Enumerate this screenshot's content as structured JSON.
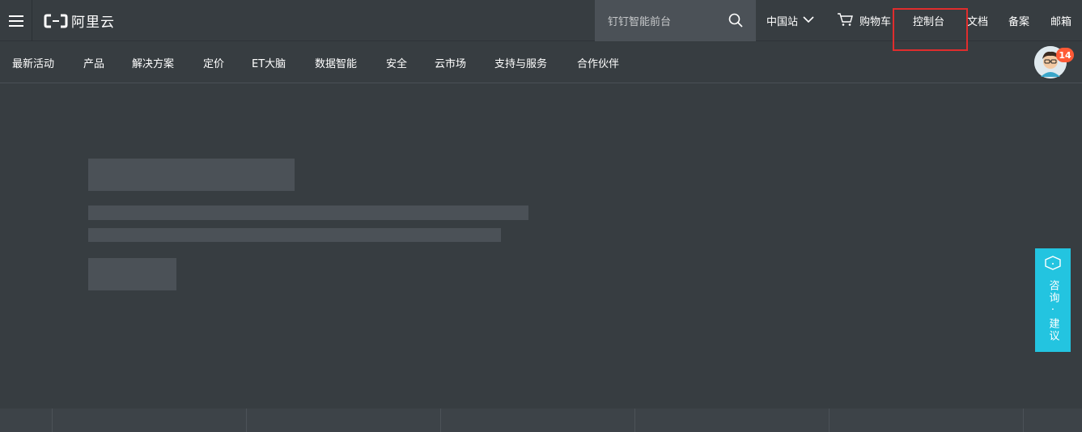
{
  "header": {
    "brand": "阿里云",
    "search_placeholder": "钉钉智能前台",
    "region": "中国站",
    "cart": "购物车",
    "console": "控制台",
    "docs": "文档",
    "beian": "备案",
    "mail": "邮箱"
  },
  "nav": {
    "items": [
      "最新活动",
      "产品",
      "解决方案",
      "定价",
      "ET大脑",
      "数据智能",
      "安全",
      "云市场",
      "支持与服务",
      "合作伙伴"
    ]
  },
  "user": {
    "notification_count": "14"
  },
  "consult": {
    "label": "咨询·建议"
  },
  "colors": {
    "background": "#373d41",
    "skeleton": "#4b5157",
    "accent_consult": "#23c4e0",
    "badge": "#ff5a36",
    "highlight": "#e02d2d"
  },
  "icons": [
    "menu-icon",
    "aliyun-logo-icon",
    "search-icon",
    "chevron-down-icon",
    "cart-icon",
    "avatar-icon",
    "chat-icon"
  ]
}
